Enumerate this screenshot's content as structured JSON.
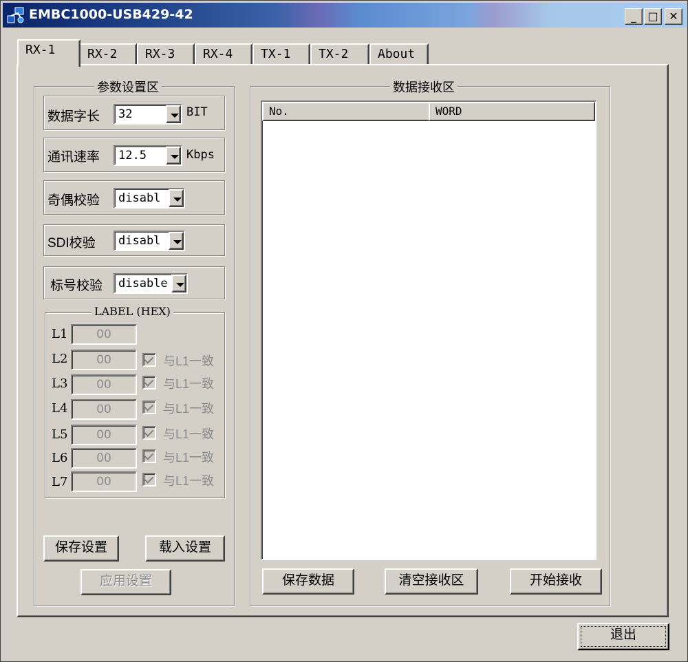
{
  "window": {
    "title": "EMBC1000-USB429-42"
  },
  "caption_buttons": {
    "minimize": "_",
    "maximize": "□",
    "close": "✕"
  },
  "tabs": [
    {
      "label": "RX-1"
    },
    {
      "label": "RX-2"
    },
    {
      "label": "RX-3"
    },
    {
      "label": "RX-4"
    },
    {
      "label": "TX-1"
    },
    {
      "label": "TX-2"
    },
    {
      "label": "About"
    }
  ],
  "params": {
    "title": "参数设置区",
    "word_length": {
      "label": "数据字长",
      "value": "32",
      "unit": "BIT"
    },
    "baud": {
      "label": "通讯速率",
      "value": "12.5",
      "unit": "Kbps"
    },
    "parity": {
      "label": "奇偶校验",
      "value": "disabl"
    },
    "sdi": {
      "label": "SDI校验",
      "value": "disabl"
    },
    "label_check": {
      "label": "标号校验",
      "value": "disable"
    },
    "label_group": {
      "title": "LABEL (HEX)",
      "same_text": "与L1一致",
      "rows": [
        {
          "name": "L1",
          "value": "00"
        },
        {
          "name": "L2",
          "value": "00"
        },
        {
          "name": "L3",
          "value": "00"
        },
        {
          "name": "L4",
          "value": "00"
        },
        {
          "name": "L5",
          "value": "00"
        },
        {
          "name": "L6",
          "value": "00"
        },
        {
          "name": "L7",
          "value": "00"
        }
      ]
    },
    "save_settings": "保存设置",
    "load_settings": "载入设置",
    "apply_settings": "应用设置"
  },
  "receive": {
    "title": "数据接收区",
    "columns": [
      "No.",
      "WORD"
    ],
    "save_data": "保存数据",
    "clear": "清空接收区",
    "start": "开始接收"
  },
  "exit_label": "退出"
}
